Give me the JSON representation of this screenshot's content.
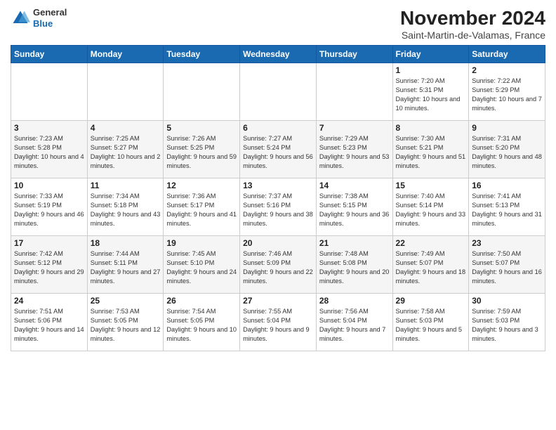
{
  "header": {
    "logo_general": "General",
    "logo_blue": "Blue",
    "title": "November 2024",
    "location": "Saint-Martin-de-Valamas, France"
  },
  "weekdays": [
    "Sunday",
    "Monday",
    "Tuesday",
    "Wednesday",
    "Thursday",
    "Friday",
    "Saturday"
  ],
  "weeks": [
    [
      {
        "day": "",
        "info": ""
      },
      {
        "day": "",
        "info": ""
      },
      {
        "day": "",
        "info": ""
      },
      {
        "day": "",
        "info": ""
      },
      {
        "day": "",
        "info": ""
      },
      {
        "day": "1",
        "info": "Sunrise: 7:20 AM\nSunset: 5:31 PM\nDaylight: 10 hours and 10 minutes."
      },
      {
        "day": "2",
        "info": "Sunrise: 7:22 AM\nSunset: 5:29 PM\nDaylight: 10 hours and 7 minutes."
      }
    ],
    [
      {
        "day": "3",
        "info": "Sunrise: 7:23 AM\nSunset: 5:28 PM\nDaylight: 10 hours and 4 minutes."
      },
      {
        "day": "4",
        "info": "Sunrise: 7:25 AM\nSunset: 5:27 PM\nDaylight: 10 hours and 2 minutes."
      },
      {
        "day": "5",
        "info": "Sunrise: 7:26 AM\nSunset: 5:25 PM\nDaylight: 9 hours and 59 minutes."
      },
      {
        "day": "6",
        "info": "Sunrise: 7:27 AM\nSunset: 5:24 PM\nDaylight: 9 hours and 56 minutes."
      },
      {
        "day": "7",
        "info": "Sunrise: 7:29 AM\nSunset: 5:23 PM\nDaylight: 9 hours and 53 minutes."
      },
      {
        "day": "8",
        "info": "Sunrise: 7:30 AM\nSunset: 5:21 PM\nDaylight: 9 hours and 51 minutes."
      },
      {
        "day": "9",
        "info": "Sunrise: 7:31 AM\nSunset: 5:20 PM\nDaylight: 9 hours and 48 minutes."
      }
    ],
    [
      {
        "day": "10",
        "info": "Sunrise: 7:33 AM\nSunset: 5:19 PM\nDaylight: 9 hours and 46 minutes."
      },
      {
        "day": "11",
        "info": "Sunrise: 7:34 AM\nSunset: 5:18 PM\nDaylight: 9 hours and 43 minutes."
      },
      {
        "day": "12",
        "info": "Sunrise: 7:36 AM\nSunset: 5:17 PM\nDaylight: 9 hours and 41 minutes."
      },
      {
        "day": "13",
        "info": "Sunrise: 7:37 AM\nSunset: 5:16 PM\nDaylight: 9 hours and 38 minutes."
      },
      {
        "day": "14",
        "info": "Sunrise: 7:38 AM\nSunset: 5:15 PM\nDaylight: 9 hours and 36 minutes."
      },
      {
        "day": "15",
        "info": "Sunrise: 7:40 AM\nSunset: 5:14 PM\nDaylight: 9 hours and 33 minutes."
      },
      {
        "day": "16",
        "info": "Sunrise: 7:41 AM\nSunset: 5:13 PM\nDaylight: 9 hours and 31 minutes."
      }
    ],
    [
      {
        "day": "17",
        "info": "Sunrise: 7:42 AM\nSunset: 5:12 PM\nDaylight: 9 hours and 29 minutes."
      },
      {
        "day": "18",
        "info": "Sunrise: 7:44 AM\nSunset: 5:11 PM\nDaylight: 9 hours and 27 minutes."
      },
      {
        "day": "19",
        "info": "Sunrise: 7:45 AM\nSunset: 5:10 PM\nDaylight: 9 hours and 24 minutes."
      },
      {
        "day": "20",
        "info": "Sunrise: 7:46 AM\nSunset: 5:09 PM\nDaylight: 9 hours and 22 minutes."
      },
      {
        "day": "21",
        "info": "Sunrise: 7:48 AM\nSunset: 5:08 PM\nDaylight: 9 hours and 20 minutes."
      },
      {
        "day": "22",
        "info": "Sunrise: 7:49 AM\nSunset: 5:07 PM\nDaylight: 9 hours and 18 minutes."
      },
      {
        "day": "23",
        "info": "Sunrise: 7:50 AM\nSunset: 5:07 PM\nDaylight: 9 hours and 16 minutes."
      }
    ],
    [
      {
        "day": "24",
        "info": "Sunrise: 7:51 AM\nSunset: 5:06 PM\nDaylight: 9 hours and 14 minutes."
      },
      {
        "day": "25",
        "info": "Sunrise: 7:53 AM\nSunset: 5:05 PM\nDaylight: 9 hours and 12 minutes."
      },
      {
        "day": "26",
        "info": "Sunrise: 7:54 AM\nSunset: 5:05 PM\nDaylight: 9 hours and 10 minutes."
      },
      {
        "day": "27",
        "info": "Sunrise: 7:55 AM\nSunset: 5:04 PM\nDaylight: 9 hours and 9 minutes."
      },
      {
        "day": "28",
        "info": "Sunrise: 7:56 AM\nSunset: 5:04 PM\nDaylight: 9 hours and 7 minutes."
      },
      {
        "day": "29",
        "info": "Sunrise: 7:58 AM\nSunset: 5:03 PM\nDaylight: 9 hours and 5 minutes."
      },
      {
        "day": "30",
        "info": "Sunrise: 7:59 AM\nSunset: 5:03 PM\nDaylight: 9 hours and 3 minutes."
      }
    ]
  ]
}
